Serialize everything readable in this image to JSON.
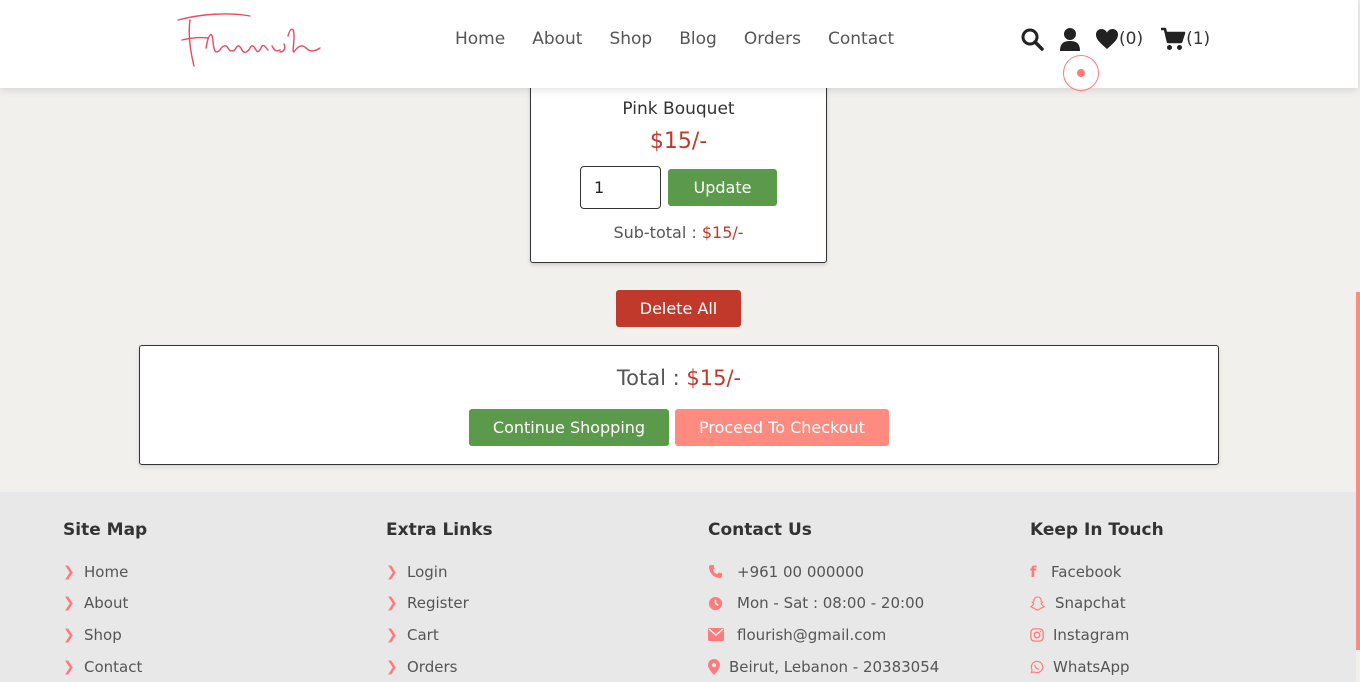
{
  "brand": {
    "logo_text": "flourish",
    "accent": "#ff7b7b",
    "green": "#5a9a4a",
    "red": "#c0392b",
    "salmon": "#ff8a80"
  },
  "nav": {
    "items": [
      "Home",
      "About",
      "Shop",
      "Blog",
      "Orders",
      "Contact"
    ]
  },
  "header_icons": {
    "search": "search-icon",
    "user": "user-icon",
    "wishlist_count": "(0)",
    "cart_count": "(1)"
  },
  "cart_item": {
    "name": "Pink Bouquet",
    "price": "$15/-",
    "quantity": "1",
    "update_label": "Update",
    "subtotal_label": "Sub-total : ",
    "subtotal_value": "$15/-"
  },
  "delete_all_label": "Delete All",
  "summary": {
    "total_label": "Total : ",
    "total_value": "$15/-",
    "continue_label": "Continue Shopping",
    "checkout_label": "Proceed To Checkout"
  },
  "footer": {
    "site_map": {
      "title": "Site Map",
      "items": [
        "Home",
        "About",
        "Shop",
        "Contact"
      ]
    },
    "extra_links": {
      "title": "Extra Links",
      "items": [
        "Login",
        "Register",
        "Cart",
        "Orders"
      ]
    },
    "contact": {
      "title": "Contact Us",
      "phone": "+961 00 000000",
      "hours": "Mon - Sat : 08:00 - 20:00",
      "email": "flourish@gmail.com",
      "address": "Beirut, Lebanon - 20383054"
    },
    "social": {
      "title": "Keep In Touch",
      "items": [
        "Facebook",
        "Snapchat",
        "Instagram",
        "WhatsApp"
      ]
    }
  }
}
